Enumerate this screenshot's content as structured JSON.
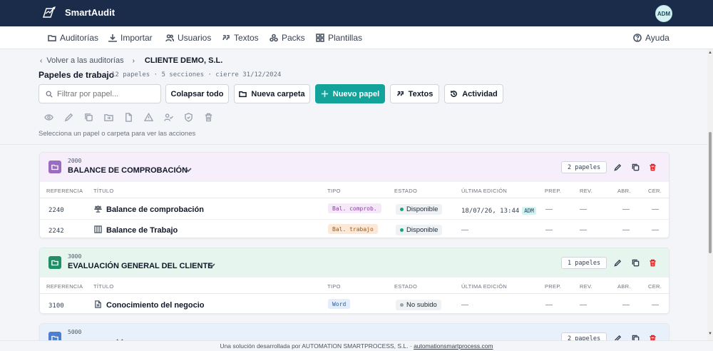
{
  "app": {
    "brand": "SmartAudit",
    "avatar": "ADM"
  },
  "nav": {
    "items": [
      {
        "label": "Auditorías",
        "icon": "folder-icon"
      },
      {
        "label": "Importar",
        "icon": "download-icon"
      },
      {
        "label": "Usuarios",
        "icon": "users-icon"
      },
      {
        "label": "Textos",
        "icon": "quote-icon"
      },
      {
        "label": "Packs",
        "icon": "packs-icon"
      },
      {
        "label": "Plantillas",
        "icon": "grid-icon"
      }
    ],
    "help": "Ayuda"
  },
  "breadcrumb": {
    "back": "Volver a las auditorías",
    "current": "CLIENTE DEMO, S.L."
  },
  "page": {
    "title": "Papeles de trabajo",
    "meta": "12 papeles · 5 secciones · cierre 31/12/2024"
  },
  "toolbar": {
    "search_placeholder": "Filtrar por papel...",
    "collapse": "Colapsar todo",
    "new_folder": "Nueva carpeta",
    "new_paper": "Nuevo papel",
    "texts": "Textos",
    "activity": "Actividad",
    "hint": "Selecciona un papel o carpeta para ver las acciones"
  },
  "table_headers": {
    "ref": "REFERENCIA",
    "title": "TÍTULO",
    "tipo": "TIPO",
    "estado": "ESTADO",
    "edit": "ÚLTIMA EDICIÓN",
    "prep": "PREP.",
    "rev": "REV.",
    "abr": "ABR.",
    "cer": "CER."
  },
  "sections": [
    {
      "code": "2000",
      "name": "BALANCE DE COMPROBACIÓN",
      "count": "2 papeles",
      "color": "#9b6bc2",
      "bg": "#f6eefb",
      "rows": [
        {
          "ref": "2240",
          "title": "Balance de comprobación",
          "icon": "scale-icon",
          "tipo": "Bal. comprob.",
          "tipo_bg": "#f5e8f8",
          "tipo_fg": "#8b3fa6",
          "estado": "Disponible",
          "dot": "#15a37a",
          "edit": "18/07/26, 13:44",
          "edit_user": "ADM",
          "prep": "—",
          "rev": "—",
          "abr": "—",
          "cer": "—"
        },
        {
          "ref": "2242",
          "title": "Balance de Trabajo",
          "icon": "columns-icon",
          "tipo": "Bal. trabajo",
          "tipo_bg": "#fbe8d6",
          "tipo_fg": "#9a5a1a",
          "estado": "Disponible",
          "dot": "#15a37a",
          "edit": "—",
          "edit_user": "",
          "prep": "—",
          "rev": "—",
          "abr": "—",
          "cer": "—"
        }
      ]
    },
    {
      "code": "3000",
      "name": "EVALUACIÓN GENERAL DEL CLIENTE",
      "count": "1 papeles",
      "color": "#1f8f6a",
      "bg": "#e6f6ef",
      "rows": [
        {
          "ref": "3100",
          "title": "Conocimiento del negocio",
          "icon": "document-icon",
          "tipo": "Word",
          "tipo_bg": "#e4eefb",
          "tipo_fg": "#2b5ea8",
          "estado": "No subido",
          "dot": "#9ca3af",
          "edit": "—",
          "edit_user": "",
          "prep": "—",
          "rev": "—",
          "abr": "—",
          "cer": "—"
        }
      ]
    },
    {
      "code": "5000",
      "name": "",
      "count": "2 papeles",
      "color": "#4d7fd0",
      "bg": "#e8f0fb",
      "rows": []
    }
  ],
  "footer": {
    "text": "Una solución desarrollada por AUTOMATION SMARTPROCESS, S.L. · ",
    "link": "automationsmartprocess.com"
  }
}
